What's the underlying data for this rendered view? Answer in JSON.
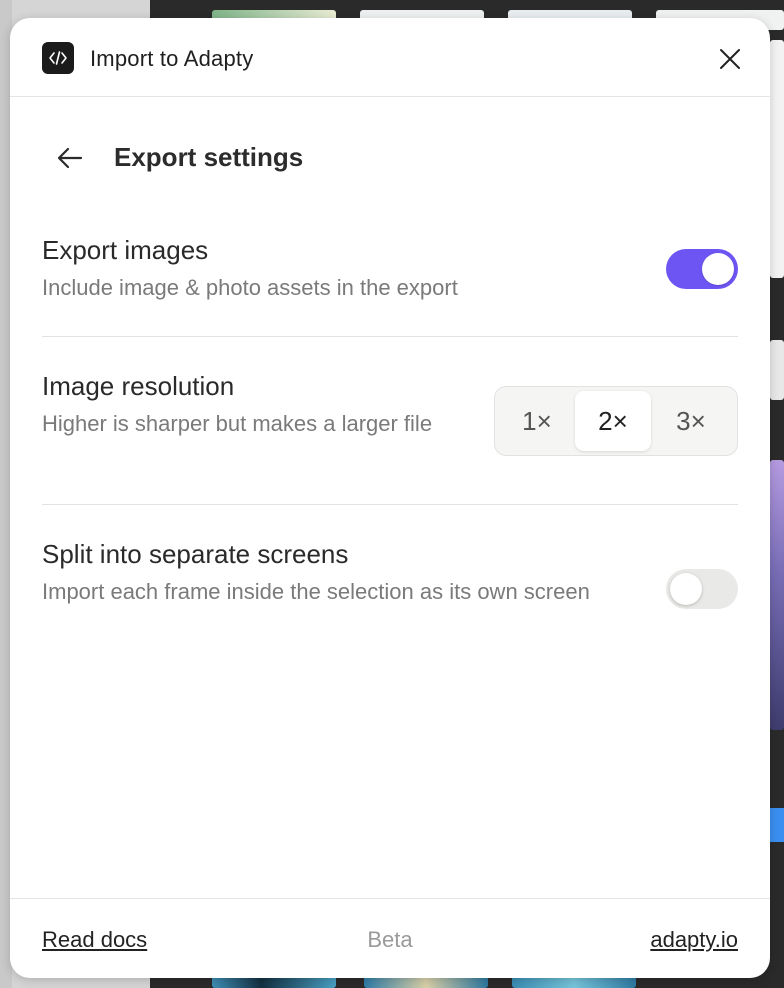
{
  "dialog": {
    "title": "Import to Adapty",
    "logo_icon": "code-brackets-icon",
    "close_icon": "close-icon"
  },
  "page": {
    "title": "Export settings",
    "back_icon": "arrow-left-icon"
  },
  "settings": {
    "export_images": {
      "title": "Export images",
      "description": "Include image & photo assets in the export",
      "enabled": true
    },
    "image_resolution": {
      "title": "Image resolution",
      "description": "Higher is sharper but makes a larger file",
      "options": [
        "1×",
        "2×",
        "3×"
      ],
      "selected": "2×"
    },
    "split_screens": {
      "title": "Split into separate screens",
      "description": "Import each frame inside the selection as its own screen",
      "enabled": false
    }
  },
  "footer": {
    "docs_link": "Read docs",
    "status": "Beta",
    "site_link": "adapty.io"
  },
  "colors": {
    "accent": "#6d55f3",
    "toggle_off": "#e9e9e7"
  }
}
